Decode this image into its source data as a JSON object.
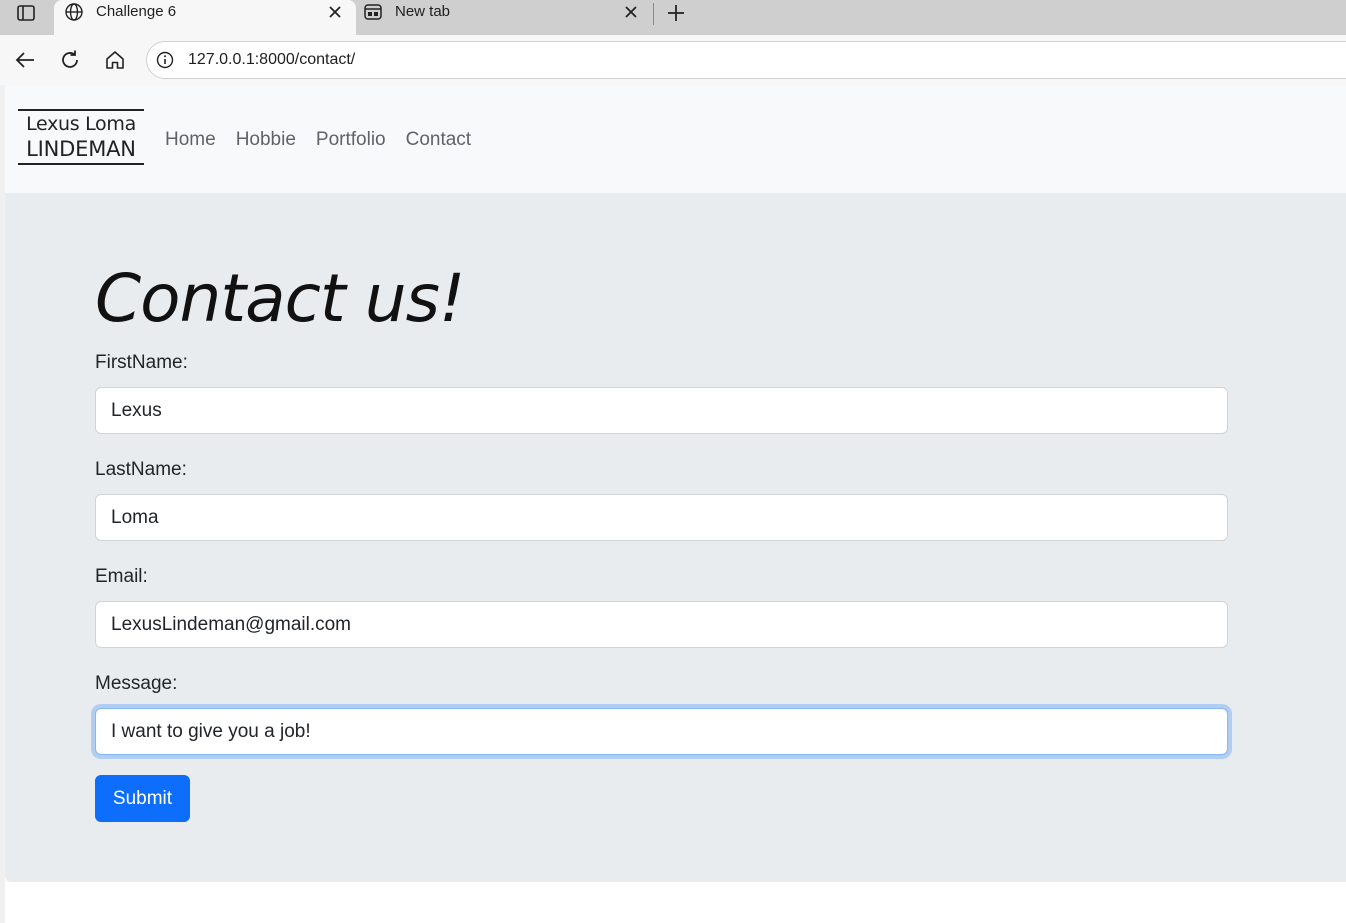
{
  "browser": {
    "tabs": [
      {
        "title": "Challenge 6",
        "icon": "globe-icon",
        "active": true
      },
      {
        "title": "New tab",
        "icon": "new-tab-page-icon",
        "active": false
      }
    ],
    "address_bar": {
      "url": "127.0.0.1:8000/contact/"
    }
  },
  "navbar": {
    "brand": {
      "line1": "Lexus Loma",
      "line2": "LINDEMAN"
    },
    "links": [
      "Home",
      "Hobbie",
      "Portfolio",
      "Contact"
    ]
  },
  "main": {
    "heading": "Contact us!",
    "fields": [
      {
        "label": "FirstName:",
        "value": "Lexus"
      },
      {
        "label": "LastName:",
        "value": "Loma"
      },
      {
        "label": "Email:",
        "value": "LexusLindeman@gmail.com"
      },
      {
        "label": "Message:",
        "value": "I want to give you a job!",
        "focused": true
      }
    ],
    "submit_label": "Submit"
  },
  "colors": {
    "primary": "#0d6efd",
    "jumbotron_bg": "#e9ecef",
    "navbar_bg": "#f8f9fa",
    "focus_ring": "#86b7fe"
  }
}
